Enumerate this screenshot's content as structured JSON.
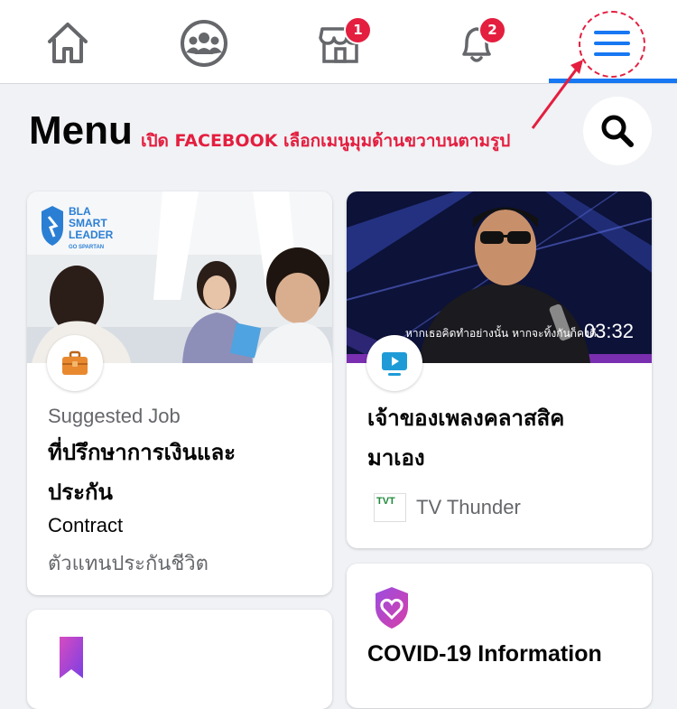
{
  "nav": {
    "items": [
      {
        "name": "home"
      },
      {
        "name": "groups"
      },
      {
        "name": "marketplace",
        "badge": "1"
      },
      {
        "name": "notifications",
        "badge": "2"
      },
      {
        "name": "menu",
        "active": true
      }
    ]
  },
  "header": {
    "title": "Menu",
    "annotation": "เปิด FACEBOOK เลือกเมนูมุมด้านขวาบนตามรูป"
  },
  "cards": {
    "job": {
      "logo_line1": "BLA",
      "logo_line2": "SMART",
      "logo_line3": "LEADER",
      "logo_line4": "GO SPARTAN",
      "category": "Suggested Job",
      "title_line1": "ที่ปรึกษาการเงินและ",
      "title_line2": "ประกัน",
      "type": "Contract",
      "subtitle": "ตัวแทนประกันชีวิต"
    },
    "video": {
      "caption": "หากเธอคิดทำอย่างนั้น หากจะทิ้งกันก็คงดี",
      "duration": "03:32",
      "title_line1": "เจ้าของเพลงคลาสสิค",
      "title_line2": "มาเอง",
      "channel": "TV Thunder",
      "channel_logo": "TVT"
    },
    "covid": {
      "title": "COVID-19 Information"
    }
  },
  "colors": {
    "accent": "#1877f2",
    "badge": "#e41e3f",
    "annotation": "#e41e3f"
  }
}
